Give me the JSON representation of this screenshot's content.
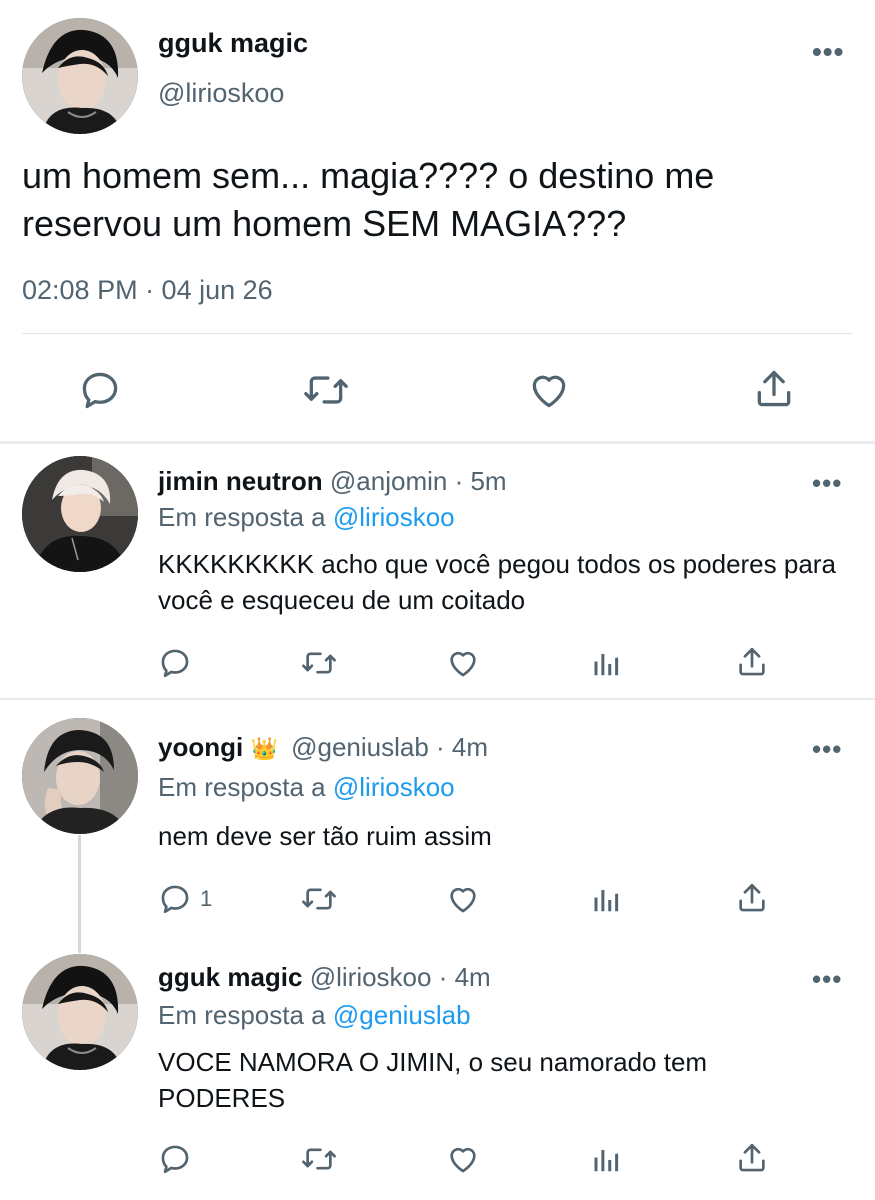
{
  "main": {
    "name": "gguk magic",
    "handle": "@lirioskoo",
    "text": "um homem sem... magia???? o destino me reservou um homem SEM MAGIA???",
    "time": "02:08 PM · 04 jun 26",
    "more_icon": "more-dots-icon",
    "actions": [
      "reply-icon",
      "retweet-icon",
      "like-icon",
      "share-icon"
    ]
  },
  "replies": [
    {
      "name": "jimin neutron",
      "handle_meta": "@anjomin · 5m",
      "reply_prefix": "Em resposta a",
      "reply_to": "@lirioskoo",
      "text": "KKKKKKKKK acho que você pegou todos os poderes para você e esqueceu de um coitado",
      "reply_count": ""
    },
    {
      "name": "yoongi",
      "badge": "👑",
      "handle_meta": "@geniuslab · 4m",
      "reply_prefix": "Em resposta a",
      "reply_to": "@lirioskoo",
      "text": "nem deve ser tão ruim assim",
      "reply_count": "1"
    },
    {
      "name": "gguk magic",
      "handle_meta": "@lirioskoo · 4m",
      "reply_prefix": "Em resposta a",
      "reply_to": "@geniuslab",
      "text": "VOCE NAMORA O JIMIN, o seu namorado tem PODERES",
      "reply_count": ""
    }
  ],
  "colors": {
    "text": "#0f1419",
    "muted": "#536471",
    "link": "#1d9bf0",
    "divider": "#e1e5e8"
  }
}
